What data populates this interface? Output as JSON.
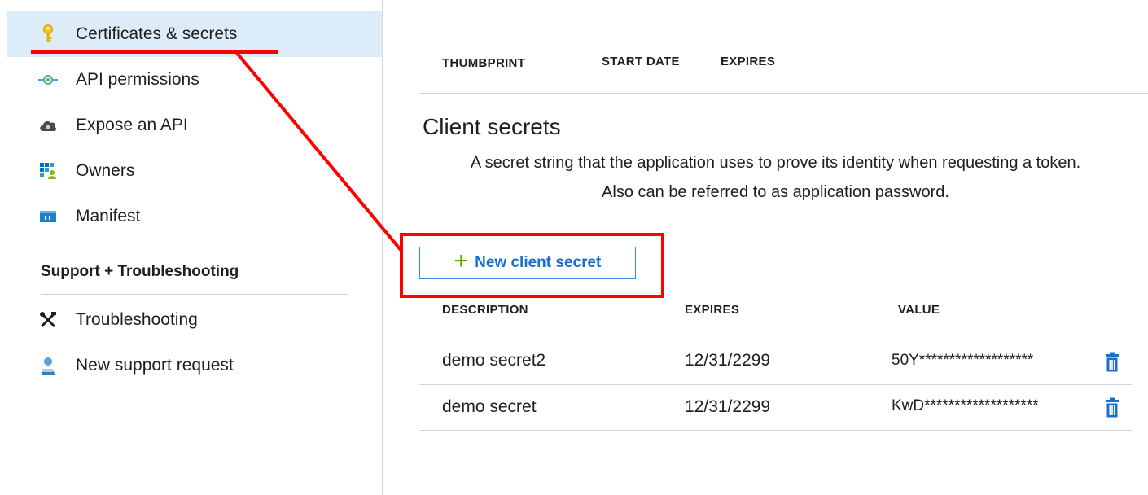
{
  "sidebar": {
    "items": [
      {
        "label": "Certificates & secrets",
        "icon": "key-icon",
        "active": true
      },
      {
        "label": "API permissions",
        "icon": "api-permissions-icon"
      },
      {
        "label": "Expose an API",
        "icon": "cloud-icon"
      },
      {
        "label": "Owners",
        "icon": "owners-icon"
      },
      {
        "label": "Manifest",
        "icon": "manifest-icon"
      }
    ],
    "support_header": "Support + Troubleshooting",
    "support_items": [
      {
        "label": "Troubleshooting",
        "icon": "tools-icon"
      },
      {
        "label": "New support request",
        "icon": "support-person-icon"
      }
    ]
  },
  "certificates": {
    "columns": [
      "THUMBPRINT",
      "START DATE",
      "EXPIRES"
    ]
  },
  "client_secrets": {
    "title": "Client secrets",
    "description_line1": "A secret string that the application uses to prove its identity when requesting a token.",
    "description_line2": "Also can be referred to as application password.",
    "new_button_label": "New client secret",
    "columns": [
      "DESCRIPTION",
      "EXPIRES",
      "VALUE"
    ],
    "rows": [
      {
        "description": "demo secret2",
        "expires": "12/31/2299",
        "value": "50Y*******************"
      },
      {
        "description": "demo secret",
        "expires": "12/31/2299",
        "value": "KwD*******************"
      }
    ]
  },
  "colors": {
    "accent_blue": "#1a6fce",
    "active_bg": "#dcecf9",
    "annotation_red": "#ff0000",
    "plus_green": "#57a300"
  }
}
